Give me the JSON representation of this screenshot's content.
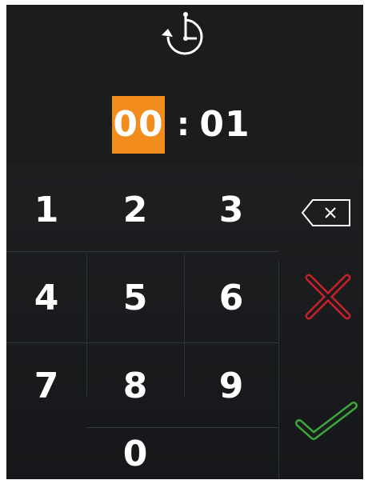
{
  "timer": {
    "hours": "00",
    "separator": ":",
    "minutes": "01"
  },
  "keypad": {
    "keys": [
      "1",
      "2",
      "3",
      "4",
      "5",
      "6",
      "7",
      "8",
      "9",
      "0"
    ]
  },
  "icons": {
    "top": "clock-icon",
    "backspace": "backspace-icon",
    "cancel": "cancel-icon",
    "confirm": "checkmark-icon"
  },
  "colors": {
    "background": "#1a1c1e",
    "highlight": "#f28c1c",
    "text": "#ffffff",
    "cancel": "#c8202a",
    "confirm": "#3aa83a"
  }
}
